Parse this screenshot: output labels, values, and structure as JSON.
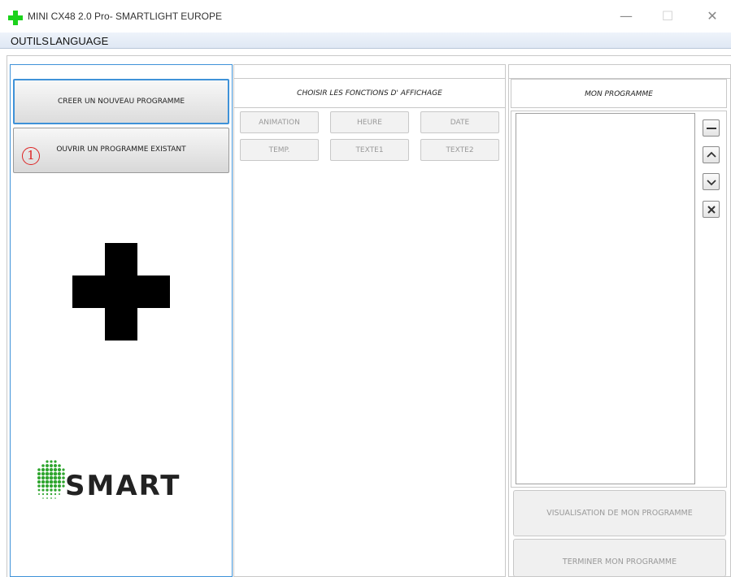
{
  "window": {
    "title": "MINI CX48 2.0 Pro- SMARTLIGHT EUROPE",
    "minimize": "—",
    "maximize": "☐",
    "close": "✕",
    "app_icon": "green-cross-icon",
    "accent": "#1bd21b"
  },
  "menu": {
    "items": [
      "OUTILS",
      "LANGUAGE"
    ]
  },
  "left": {
    "create_button": "CREER UN NOUVEAU PROGRAMME",
    "open_button": "OUVRIR UN PROGRAMME EXISTANT",
    "marker": "1",
    "logo_icon": "black-cross-icon",
    "brand_text": "SMART",
    "brand_dots_color": "#2ea52e"
  },
  "middle": {
    "header": "CHOISIR LES FONCTIONS D' AFFICHAGE",
    "functions": [
      "ANIMATION",
      "HEURE",
      "DATE",
      "TEMP.",
      "TEXTE1",
      "TEXTE2"
    ]
  },
  "right": {
    "header": "MON PROGRAMME",
    "side_icons": [
      "minus-icon",
      "chevron-up-icon",
      "chevron-down-icon",
      "close-icon"
    ],
    "preview_button": "VISUALISATION DE MON PROGRAMME",
    "finish_button": "TERMINER MON PROGRAMME"
  },
  "colors": {
    "panel_border_active": "#3f92d8",
    "disabled_text": "#9a9a9a"
  }
}
